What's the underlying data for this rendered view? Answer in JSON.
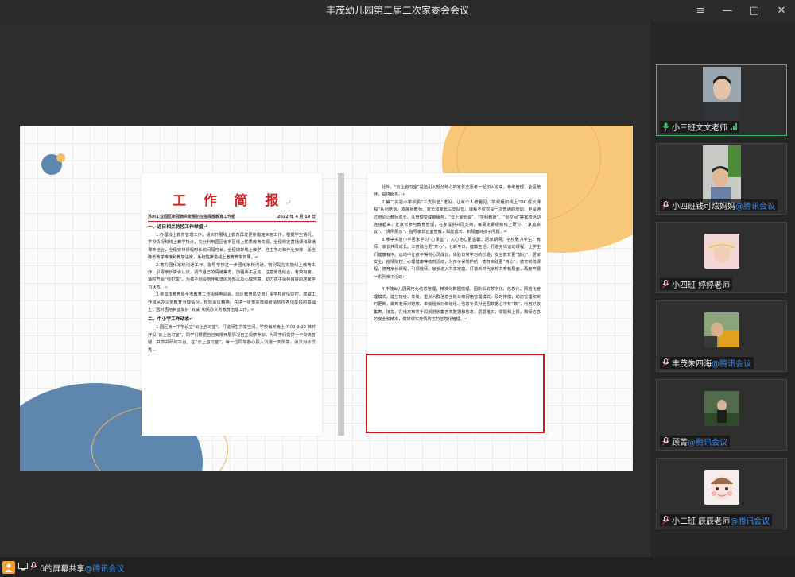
{
  "window": {
    "title": "丰茂幼儿园第二届二次家委会会议"
  },
  "window_buttons": {
    "menu": "≡",
    "minimize": "—",
    "maximize": "□",
    "close": "✕"
  },
  "document": {
    "title": "工 作 简 报",
    "title_mark": "↵",
    "issuer": "苏州工业园区新冠肺炎疫情防控指挥部教育工作组",
    "date": "2022 年 4 月 19 日",
    "left_paragraphs": [
      {
        "type": "h",
        "text": "一、近日相关防控工作举措↵"
      },
      {
        "type": "p",
        "text": "1.办理线上教育管理工作。组织开展线上教育再发更新措施实施工作，根据学生情况，学校情况和线上教学特点，充分利用园区省市区线上优质教育资源，全程规定直播课和录播课等结合，全程安排课程时长和间隔时长，全程做好线上教学、自主学习和作业安排，适当降低教学难度和教学进度，系统性推进线上教育教学效果。↵"
      },
      {
        "type": "p",
        "text": "2.着力强化家校沟通工作。指导学校进一步强化家校沟通，特别是在实施线上教育工作，引导家长学会认识，调节自己的情绪焦虑，加强亲子互动，注意劳逸结合，有效有度，适时开会“侵犯理”。为孩子创设陪伴和谐的外部以及心理环境，助力孩子保持良好的居家学习状态。↵"
      },
      {
        "type": "p",
        "text": "3.参加市教育局全市教育工作视频电调会。园区教育局交流汇报学校疫情防控、双减工作和民办义务教育治理情况，校际会议精神。在进一步落实落细疫情防控各项举措的基础上，因时因地制宜做好“双减”和民办义务教育治理工作。↵"
      },
      {
        "type": "h",
        "text": "二、中小学工作动态↵"
      },
      {
        "type": "p",
        "text": "1.园区第一中学设立“云上自习室”。打造师生共享空间，学校每天晚上 7:00-9:00 准时开设“云上自习室”，同学们根据自己安排开展情况自主观察参加，为同学们提供一个交流答疑、共享共研的平台。在“云上自习室”，每一位同学静心投入沉浸一天所学，设法对标优秀…"
      }
    ],
    "right_paragraphs": [
      {
        "type": "p",
        "text": "此外，“云上自习室”是还引入部分热心的家长志愿者一起加入进来，参考管理，全程陪伴，提供服务。↵"
      },
      {
        "type": "p",
        "text": "2.第二实验小学积极“三支队伍”建设，让每个人被看见。学校组织线上“OK 成长课程”系列培训，发展师教师、家长和家长三支队伍。课程不仅仅是一次普通的培训，更是通过培训让教师成长、从管理变成被服务，“云上家长会”、“学科教研”、“创空间”等家校活动连接起来，让家长参与教育管理，在家提供共同支持，每周定期组织线上研讨、“家庭会议”、“课例展示”，指导家长正面管教，赋能成长、积极面对孩子问题。↵"
      },
      {
        "type": "p",
        "text": "3.唯亭实验小学居家学习“心课堂”，入心走心更温馨。居家期间，学校致力学生、教师、家长共同成长。三育融合更“开心”，七彩平日，健康生活，打造身体运动课程，让学生们健康有序。运动中让孩子得到心灵成长，体验日常学习的乐趣；安全教育更“放心”，居家安全、疫情防控、心理健康等教育活动，为孩子保驾护航；德育实践更“用心”，德育实践课程，德育家长课程，引领教师、家长进入共享家庭，打造新时代家校共育新局面，再度开展一系列亲子活动↵"
      },
      {
        "type": "p",
        "text": "4.丰茂幼儿园网格化信息管理，精准化数据梳理。园所采取数字化、信息化、网格化管理模式，建立班级、年级、重点人群信息全链三级网格管理模式，及时排摸，动态管理和实时更新，做到老师对班级、年级组长对年级组、信息专员对全园数据心中有“数”，利用好收集表、接龙、在线文档等手段规范收集各类数据和信息，层层落实，掌握和上报，确保信息的安全和精准，做好做实疫情防控的信息化管理。↵",
        "highlighted": true
      }
    ]
  },
  "participants": [
    {
      "name": "小三班文文老师",
      "suffix": "",
      "active": true,
      "video": true
    },
    {
      "name": "小四班钱可炫妈妈",
      "suffix": "@腾讯会议",
      "active": false,
      "video": true
    },
    {
      "name": "小四班 婷婷老师",
      "suffix": "",
      "active": false,
      "video": false
    },
    {
      "name": "丰茂朱四海",
      "suffix": "@腾讯会议",
      "active": false,
      "video": false
    },
    {
      "name": "顾菁",
      "suffix": "@腾讯会议",
      "active": false,
      "video": false
    },
    {
      "name": "小二班  辰辰老师",
      "suffix": "@腾讯会议",
      "active": false,
      "video": false
    }
  ],
  "bottom": {
    "share_text": "û的屏幕共享",
    "share_suffix": "@腾讯会议"
  },
  "colors": {
    "accent_green": "#3fb96b",
    "tencent_blue": "#3c8cf0",
    "highlight_red": "#d01818",
    "doc_red": "#d42020"
  }
}
